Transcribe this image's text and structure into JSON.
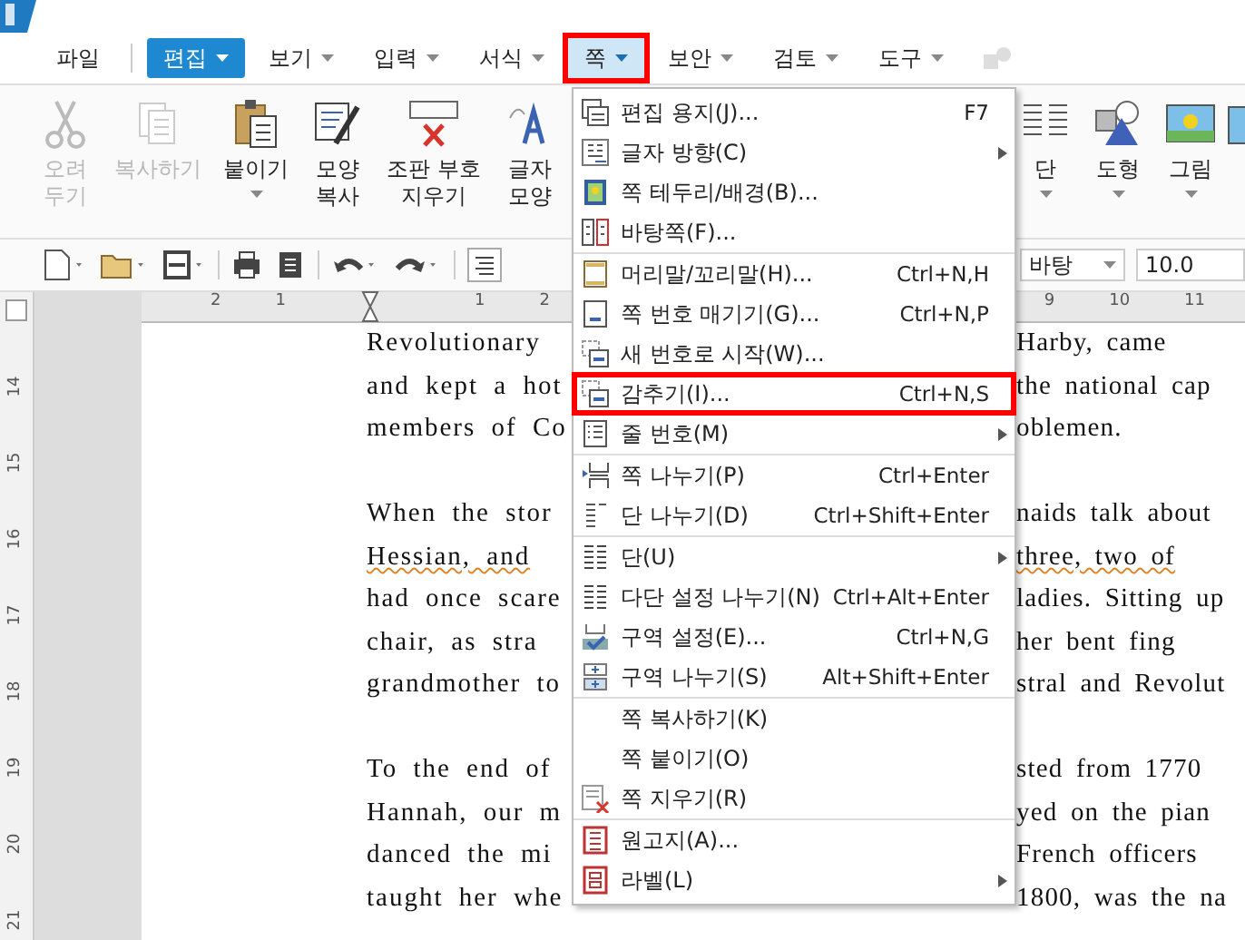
{
  "menu_bar": [
    {
      "label": "파일",
      "selected": false,
      "dropdown": false
    },
    {
      "label": "편집",
      "selected": true,
      "dropdown": true
    },
    {
      "label": "보기",
      "selected": false,
      "dropdown": true
    },
    {
      "label": "입력",
      "selected": false,
      "dropdown": true
    },
    {
      "label": "서식",
      "selected": false,
      "dropdown": true
    },
    {
      "label": "쪽",
      "selected": false,
      "open": true,
      "dropdown": true
    },
    {
      "label": "보안",
      "selected": false,
      "dropdown": true
    },
    {
      "label": "검토",
      "selected": false,
      "dropdown": true
    },
    {
      "label": "도구",
      "selected": false,
      "dropdown": true
    }
  ],
  "ribbon_left": [
    {
      "lines": [
        "오려",
        "두기"
      ],
      "disabled": true,
      "dropdown": false
    },
    {
      "lines": [
        "복사하기"
      ],
      "disabled": true,
      "dropdown": false
    },
    {
      "lines": [
        "붙이기"
      ],
      "disabled": false,
      "dropdown": true
    },
    {
      "lines": [
        "모양",
        "복사"
      ],
      "disabled": false,
      "dropdown": false
    },
    {
      "lines": [
        "조판 부호",
        "지우기"
      ],
      "disabled": false,
      "dropdown": false
    },
    {
      "lines": [
        "글자",
        "모양"
      ],
      "disabled": false,
      "dropdown": false
    }
  ],
  "ribbon_right": [
    {
      "lines": [
        "단"
      ],
      "disabled": false,
      "dropdown": true
    },
    {
      "lines": [
        "도형"
      ],
      "disabled": false,
      "dropdown": true
    },
    {
      "lines": [
        "그림"
      ],
      "disabled": false,
      "dropdown": true
    }
  ],
  "toolbar": {
    "font": "바탕",
    "font_size": "10.0"
  },
  "ruler": {
    "left_marks": [
      "2",
      "1",
      "1",
      "2"
    ],
    "right_marks": [
      "9",
      "10",
      "11"
    ],
    "vertical_marks": [
      "14",
      "15",
      "16",
      "17",
      "18",
      "19",
      "20",
      "21"
    ]
  },
  "document_paragraphs": [
    {
      "lines": [
        {
          "left": "Revolutionary",
          "right": "Harby, came",
          "misspelled": false
        },
        {
          "left": "and kept a hot",
          "right": "the national cap",
          "misspelled": false
        },
        {
          "left": "members of Co",
          "right": "oblemen.",
          "misspelled": false
        }
      ]
    },
    {
      "lines": [
        {
          "left": "When the stor",
          "right": "naids talk about",
          "misspelled": false
        },
        {
          "left": "Hessian, and",
          "right": "three, two of",
          "misspelled": true
        },
        {
          "left": "had once scare",
          "right": "ladies. Sitting up",
          "misspelled": false
        },
        {
          "left": "chair, as stra",
          "right": "her bent fing",
          "misspelled": false
        },
        {
          "left": "grandmother to",
          "right": "stral and Revolut",
          "misspelled": false
        }
      ]
    },
    {
      "lines": [
        {
          "left": "To the end of",
          "right": "sted from 1770",
          "misspelled": false
        },
        {
          "left": "Hannah, our m",
          "right": "yed on the pian",
          "misspelled": false
        },
        {
          "left": "danced the mi",
          "right": "French officers",
          "misspelled": false
        },
        {
          "left": "taught her whe",
          "right": "1800, was the na",
          "misspelled": false
        }
      ]
    }
  ],
  "dropdown_menu": {
    "groups": [
      [
        {
          "label": "편집 용지(J)...",
          "shortcut": "F7",
          "submenu": false,
          "highlighted": false
        },
        {
          "label": "글자 방향(C)",
          "submenu": true,
          "highlighted": false
        },
        {
          "label": "쪽 테두리/배경(B)...",
          "submenu": false,
          "highlighted": false
        },
        {
          "label": "바탕쪽(F)...",
          "submenu": false,
          "highlighted": false
        }
      ],
      [
        {
          "label": "머리말/꼬리말(H)...",
          "shortcut": "Ctrl+N,H",
          "submenu": false,
          "highlighted": false
        },
        {
          "label": "쪽 번호 매기기(G)...",
          "shortcut": "Ctrl+N,P",
          "submenu": false,
          "highlighted": false
        },
        {
          "label": "새 번호로 시작(W)...",
          "submenu": false,
          "highlighted": false
        },
        {
          "label": "감추기(I)...",
          "shortcut": "Ctrl+N,S",
          "submenu": false,
          "highlighted": true
        },
        {
          "label": "줄 번호(M)",
          "submenu": true,
          "highlighted": false
        }
      ],
      [
        {
          "label": "쪽 나누기(P)",
          "shortcut": "Ctrl+Enter",
          "submenu": false,
          "highlighted": false
        },
        {
          "label": "단 나누기(D)",
          "shortcut": "Ctrl+Shift+Enter",
          "submenu": false,
          "highlighted": false
        }
      ],
      [
        {
          "label": "단(U)",
          "submenu": true,
          "highlighted": false
        },
        {
          "label": "다단 설정 나누기(N)",
          "shortcut": "Ctrl+Alt+Enter",
          "submenu": false,
          "highlighted": false
        },
        {
          "label": "구역 설정(E)...",
          "shortcut": "Ctrl+N,G",
          "submenu": false,
          "highlighted": false
        },
        {
          "label": "구역 나누기(S)",
          "shortcut": "Alt+Shift+Enter",
          "submenu": false,
          "highlighted": false
        }
      ],
      [
        {
          "label": "쪽 복사하기(K)",
          "submenu": false,
          "highlighted": false
        },
        {
          "label": "쪽 붙이기(O)",
          "submenu": false,
          "highlighted": false
        },
        {
          "label": "쪽 지우기(R)",
          "submenu": false,
          "highlighted": false
        }
      ],
      [
        {
          "label": "원고지(A)...",
          "submenu": false,
          "highlighted": false
        },
        {
          "label": "라벨(L)",
          "submenu": true,
          "highlighted": false
        }
      ]
    ]
  }
}
